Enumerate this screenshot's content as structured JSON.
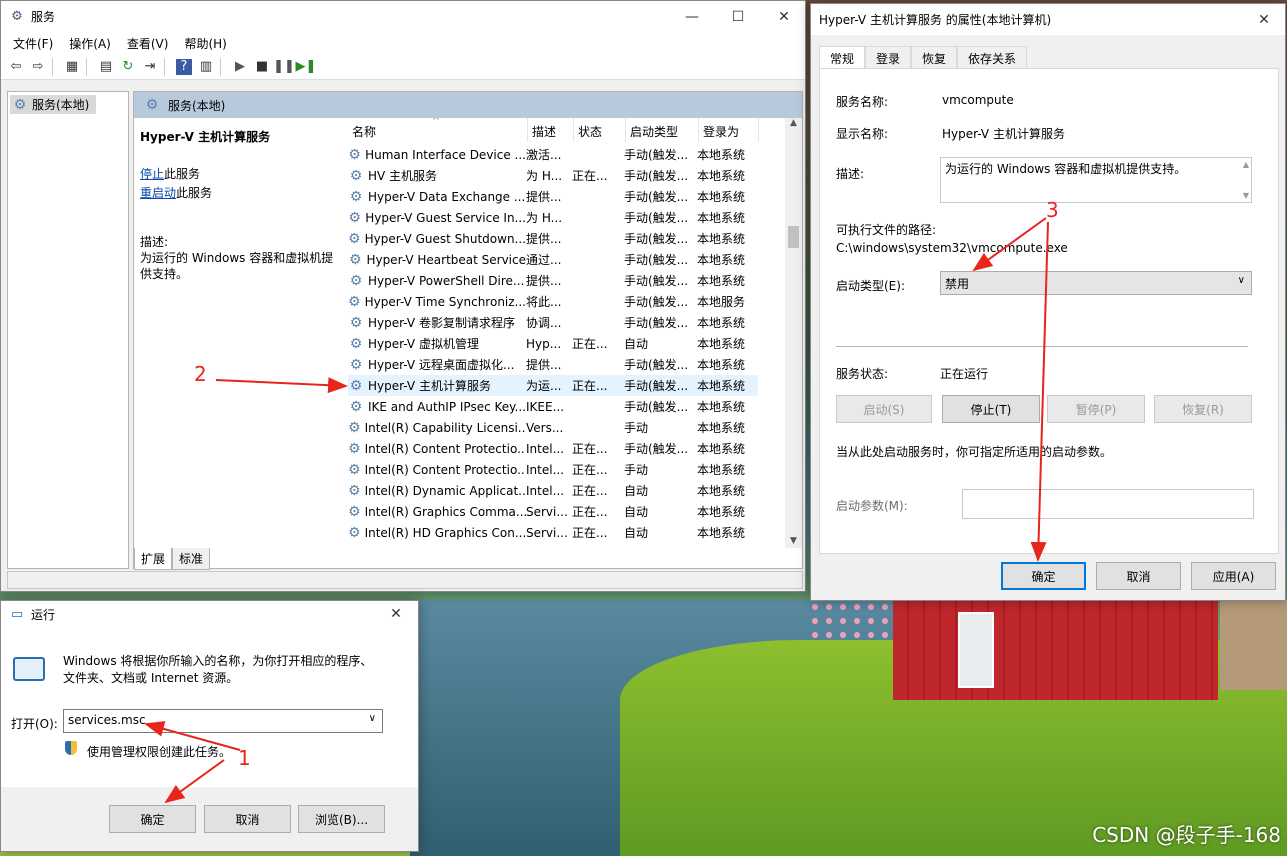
{
  "services_window": {
    "title": "服务",
    "menu": [
      "文件(F)",
      "操作(A)",
      "查看(V)",
      "帮助(H)"
    ],
    "tree_root": "服务(本地)",
    "panel_header": "服务(本地)",
    "selected_service_name": "Hyper-V 主机计算服务",
    "stop_link": "停止",
    "stop_suffix": "此服务",
    "restart_link": "重启动",
    "restart_suffix": "此服务",
    "description_label": "描述:",
    "description": "为运行的 Windows 容器和虚拟机提供支持。",
    "columns": [
      "名称",
      "描述",
      "状态",
      "启动类型",
      "登录为"
    ],
    "rows": [
      [
        "Human Interface Device ...",
        "激活...",
        "",
        "手动(触发...",
        "本地系统"
      ],
      [
        "HV 主机服务",
        "为 H...",
        "正在...",
        "手动(触发...",
        "本地系统"
      ],
      [
        "Hyper-V Data Exchange ...",
        "提供...",
        "",
        "手动(触发...",
        "本地系统"
      ],
      [
        "Hyper-V Guest Service In...",
        "为 H...",
        "",
        "手动(触发...",
        "本地系统"
      ],
      [
        "Hyper-V Guest Shutdown...",
        "提供...",
        "",
        "手动(触发...",
        "本地系统"
      ],
      [
        "Hyper-V Heartbeat Service",
        "通过...",
        "",
        "手动(触发...",
        "本地系统"
      ],
      [
        "Hyper-V PowerShell Dire...",
        "提供...",
        "",
        "手动(触发...",
        "本地系统"
      ],
      [
        "Hyper-V Time Synchroniz...",
        "将此...",
        "",
        "手动(触发...",
        "本地服务"
      ],
      [
        "Hyper-V 卷影复制请求程序",
        "协调...",
        "",
        "手动(触发...",
        "本地系统"
      ],
      [
        "Hyper-V 虚拟机管理",
        "Hyp...",
        "正在...",
        "自动",
        "本地系统"
      ],
      [
        "Hyper-V 远程桌面虚拟化...",
        "提供...",
        "",
        "手动(触发...",
        "本地系统"
      ],
      [
        "Hyper-V 主机计算服务",
        "为运...",
        "正在...",
        "手动(触发...",
        "本地系统"
      ],
      [
        "IKE and AuthIP IPsec Key...",
        "IKEE...",
        "",
        "手动(触发...",
        "本地系统"
      ],
      [
        "Intel(R) Capability Licensi...",
        "Vers...",
        "",
        "手动",
        "本地系统"
      ],
      [
        "Intel(R) Content Protectio...",
        "Intel...",
        "正在...",
        "手动(触发...",
        "本地系统"
      ],
      [
        "Intel(R) Content Protectio...",
        "Intel...",
        "正在...",
        "手动",
        "本地系统"
      ],
      [
        "Intel(R) Dynamic Applicat...",
        "Intel...",
        "正在...",
        "自动",
        "本地系统"
      ],
      [
        "Intel(R) Graphics Comma...",
        "Servi...",
        "正在...",
        "自动",
        "本地系统"
      ],
      [
        "Intel(R) HD Graphics Con...",
        "Servi...",
        "正在...",
        "自动",
        "本地系统"
      ]
    ],
    "selected_row": 11,
    "bottom_tabs": [
      "扩展",
      "标准"
    ]
  },
  "properties_dialog": {
    "title": "Hyper-V 主机计算服务 的属性(本地计算机)",
    "tabs": [
      "常规",
      "登录",
      "恢复",
      "依存关系"
    ],
    "service_name_label": "服务名称:",
    "service_name": "vmcompute",
    "display_name_label": "显示名称:",
    "display_name": "Hyper-V 主机计算服务",
    "description_label": "描述:",
    "description": "为运行的 Windows 容器和虚拟机提供支持。",
    "exe_path_label": "可执行文件的路径:",
    "exe_path": "C:\\windows\\system32\\vmcompute.exe",
    "startup_type_label": "启动类型(E):",
    "startup_type": "禁用",
    "status_label": "服务状态:",
    "status": "正在运行",
    "start_button": "启动(S)",
    "stop_button": "停止(T)",
    "pause_button": "暂停(P)",
    "resume_button": "恢复(R)",
    "hint": "当从此处启动服务时，你可指定所适用的启动参数。",
    "params_label": "启动参数(M):",
    "params_value": "",
    "ok_button": "确定",
    "cancel_button": "取消",
    "apply_button": "应用(A)"
  },
  "run_dialog": {
    "title": "运行",
    "message": "Windows 将根据你所输入的名称，为你打开相应的程序、文件夹、文档或 Internet 资源。",
    "open_label": "打开(O):",
    "open_value": "services.msc",
    "admin_note": "使用管理权限创建此任务。",
    "ok_button": "确定",
    "cancel_button": "取消",
    "browse_button": "浏览(B)..."
  },
  "annotations": [
    "1",
    "2",
    "3"
  ],
  "watermark": "CSDN @段子手-168",
  "colors": {
    "annotation": "#e8251b",
    "selection": "#e5f3ff",
    "primary_border": "#0078d7"
  }
}
